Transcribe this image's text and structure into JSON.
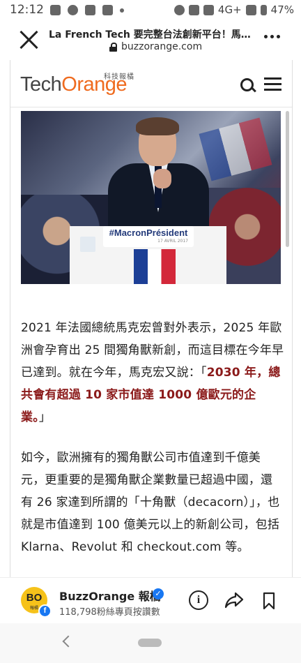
{
  "status_bar": {
    "time": "12:12",
    "network": "4G+",
    "battery": "47%"
  },
  "app_bar": {
    "title": "La French Tech 要完整台法創新平台！馬…",
    "url": "buzzorange.com"
  },
  "site": {
    "logo_tech": "Tech",
    "logo_orange": "Orange",
    "logo_sub": "科技報橘"
  },
  "hero": {
    "podium_tag": "#MacronPrésident",
    "podium_date": "17 AVRIL 2017"
  },
  "article": {
    "para1_text": "2021 年法國總統馬克宏曾對外表示，2025 年歐洲會孕育出 25 間獨角獸新創，而這目標在今年早已達到。就在今年，馬克宏又說：「",
    "para1_emph": "2030 年，總共會有超過 10 家市值達 1000 億歐元的企業。",
    "para1_end": "」",
    "para2": "如今，歐洲擁有的獨角獸公司市值達到千億美元，更重要的是獨角獸企業數量已超過中國，還有 26 家達到所謂的「十角獸（decacorn）」，也就是市值達到 100 億美元以上的新創公司，包括 Klarna、Revolut 和 checkout.com 等。"
  },
  "fb_bar": {
    "avatar_text": "BO",
    "avatar_sub": "報橘",
    "page_name": "BuzzOrange 報橘",
    "followers": "118,798粉絲專頁按讚數"
  },
  "colors": {
    "brand_orange": "#ef6b1f",
    "emphasis_red": "#8b1a1a",
    "facebook_blue": "#1877f2",
    "avatar_yellow": "#f6c21a"
  },
  "icons": [
    "close-icon",
    "lock-icon",
    "more-vert-icon",
    "search-icon",
    "menu-icon",
    "info-icon",
    "share-icon",
    "bookmark-icon",
    "back-chevron-icon",
    "home-pill-icon"
  ]
}
